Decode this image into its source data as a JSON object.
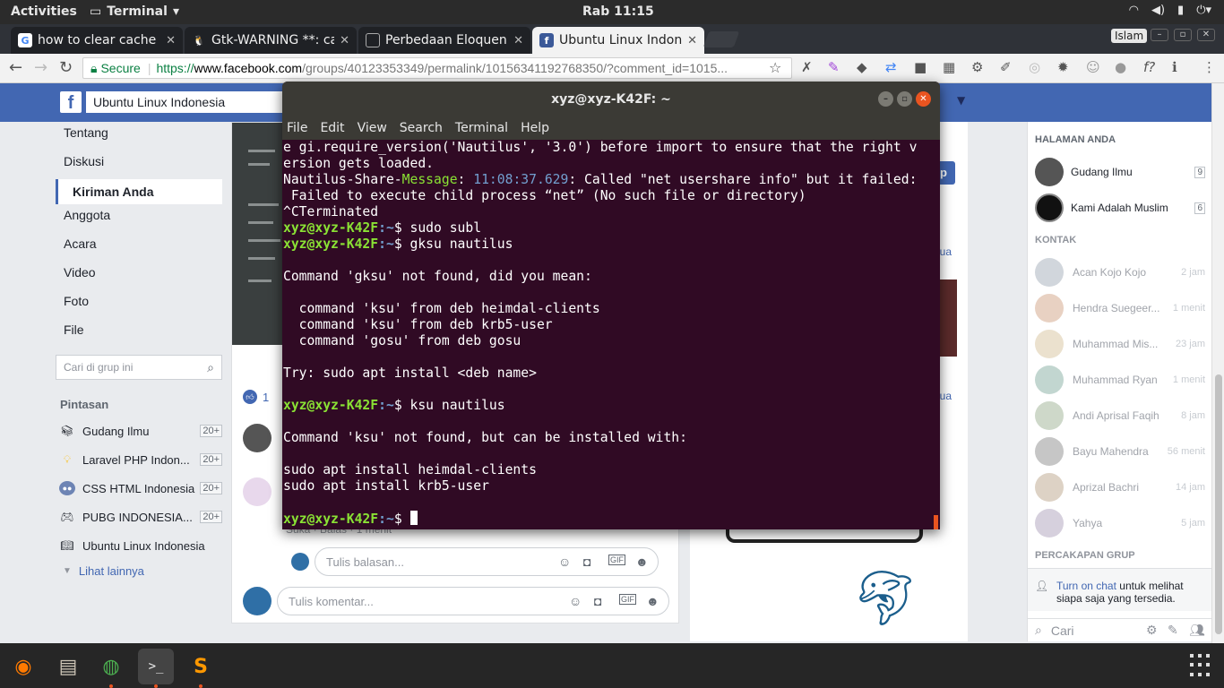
{
  "topbar": {
    "activities": "Activities",
    "app_menu": "Terminal",
    "clock": "Rab 11:15",
    "tray_icons": [
      "wifi-icon",
      "volume-icon",
      "battery-icon",
      "power-icon"
    ]
  },
  "tabs": [
    {
      "title": "how to clear cache r",
      "favicon": "google-icon"
    },
    {
      "title": "Gtk-WARNING **: ca",
      "favicon": "linux-icon"
    },
    {
      "title": "Perbedaan Eloquen",
      "favicon": "page-icon"
    },
    {
      "title": "Ubuntu Linux Indon",
      "favicon": "facebook-icon"
    }
  ],
  "profile_label": "Islam",
  "address": {
    "secure_label": "Secure",
    "scheme": "https://",
    "host": "www.facebook.com",
    "path": "/groups/40123353349/permalink/10156341192768350/?comment_id=1015..."
  },
  "facebook": {
    "search_value": "Ubuntu Linux Indonesia",
    "left_nav": [
      "Tentang",
      "Diskusi",
      "Kiriman Anda",
      "Anggota",
      "Acara",
      "Video",
      "Foto",
      "File"
    ],
    "active_nav": "Kiriman Anda",
    "group_search_placeholder": "Cari di grup ini",
    "pintasan_label": "Pintasan",
    "shortcuts": [
      {
        "name": "Gudang Ilmu",
        "count": "20+"
      },
      {
        "name": "Laravel PHP Indon...",
        "count": "20+"
      },
      {
        "name": "CSS HTML Indonesia",
        "count": "20+"
      },
      {
        "name": "PUBG INDONESIA...",
        "count": "20+"
      },
      {
        "name": "Ubuntu Linux Indonesia",
        "count": ""
      }
    ],
    "see_more": "Lihat lainnya",
    "like_count": "1",
    "reply_meta": "Suka · Balas · 1 menit",
    "reply_placeholder": "Tulis balasan...",
    "comment_placeholder": "Tulis komentar...",
    "mid_links": [
      "p",
      "nua",
      "nua"
    ],
    "chat": {
      "pages_header": "HALAMAN ANDA",
      "pages": [
        {
          "name": "Gudang Ilmu",
          "count": "9"
        },
        {
          "name": "Kami Adalah Muslim",
          "count": "6"
        }
      ],
      "contacts_header": "KONTAK",
      "contacts": [
        {
          "name": "Acan Kojo Kojo",
          "time": "2 jam"
        },
        {
          "name": "Hendra Suegeer...",
          "time": "1 menit"
        },
        {
          "name": "Muhammad Mis...",
          "time": "23 jam"
        },
        {
          "name": "Muhammad Ryan",
          "time": "1 menit"
        },
        {
          "name": "Andi Aprisal Faqih",
          "time": "8 jam"
        },
        {
          "name": "Bayu Mahendra",
          "time": "56 menit"
        },
        {
          "name": "Aprizal Bachri",
          "time": "14 jam"
        },
        {
          "name": "Yahya",
          "time": "5 jam"
        }
      ],
      "group_chats_header": "PERCAKAPAN GRUP",
      "turn_on_chat": "Turn on chat",
      "turn_on_chat_rest": " untuk melihat siapa saja yang tersedia.",
      "search_placeholder": "Cari"
    }
  },
  "terminal": {
    "title": "xyz@xyz-K42F: ~",
    "menu": [
      "File",
      "Edit",
      "View",
      "Search",
      "Terminal",
      "Help"
    ],
    "prompt_user": "xyz@xyz-K42F",
    "prompt_path": ":~",
    "lines": {
      "l1": "e gi.require_version('Nautilus', '3.0') before import to ensure that the right v",
      "l2": "ersion gets loaded.",
      "l3a": "Nautilus-Share-",
      "l3b": "Message",
      "l3c": ": ",
      "l3d": "11:08:37.629",
      "l3e": ": Called \"net usershare info\" but it failed:",
      "l4": " Failed to execute child process “net” (No such file or directory)",
      "l5": "^CTerminated",
      "cmd1": "$ sudo subl",
      "cmd2": "$ gksu nautilus",
      "l8": "Command 'gksu' not found, did you mean:",
      "l10": "  command 'ksu' from deb heimdal-clients",
      "l11": "  command 'ksu' from deb krb5-user",
      "l12": "  command 'gosu' from deb gosu",
      "l14": "Try: sudo apt install <deb name>",
      "cmd3": "$ ksu nautilus",
      "l18": "Command 'ksu' not found, but can be installed with:",
      "l20": "sudo apt install heimdal-clients",
      "l21": "sudo apt install krb5-user",
      "cmd4": "$ "
    }
  },
  "dock": [
    "firefox-icon",
    "files-icon",
    "chrome-icon",
    "terminal-icon",
    "sublime-icon"
  ],
  "colors": {
    "terminal_bg": "#300a24",
    "prompt_green": "#8ae234",
    "prompt_blue": "#729fcf",
    "facebook_blue": "#4267b2",
    "ubuntu_orange": "#e95420"
  }
}
